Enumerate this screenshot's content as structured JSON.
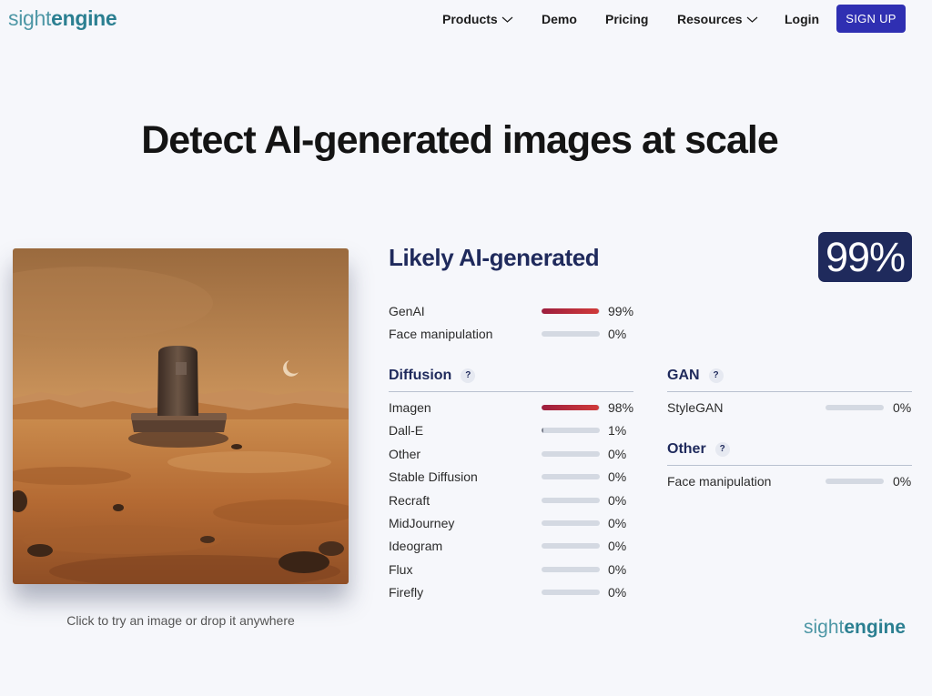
{
  "nav": {
    "logo_part1": "sight",
    "logo_part2": "engine",
    "items": [
      {
        "label": "Products",
        "has_dropdown": true
      },
      {
        "label": "Demo",
        "has_dropdown": false
      },
      {
        "label": "Pricing",
        "has_dropdown": false
      },
      {
        "label": "Resources",
        "has_dropdown": true
      },
      {
        "label": "Login",
        "has_dropdown": false
      }
    ],
    "signup_label": "SIGN UP"
  },
  "hero": {
    "title": "Detect AI-generated images at scale"
  },
  "demo": {
    "drop_hint": "Click to try an image or drop it anywhere"
  },
  "result": {
    "verdict": "Likely AI-generated",
    "score": "99%",
    "summary": [
      {
        "label": "GenAI",
        "value": 99,
        "pct": "99%"
      },
      {
        "label": "Face manipulation",
        "value": 0,
        "pct": "0%"
      }
    ],
    "diffusion": {
      "title": "Diffusion",
      "help": "?",
      "rows": [
        {
          "label": "Imagen",
          "value": 98,
          "pct": "98%"
        },
        {
          "label": "Dall-E",
          "value": 1,
          "pct": "1%"
        },
        {
          "label": "Other",
          "value": 0,
          "pct": "0%"
        },
        {
          "label": "Stable Diffusion",
          "value": 0,
          "pct": "0%"
        },
        {
          "label": "Recraft",
          "value": 0,
          "pct": "0%"
        },
        {
          "label": "MidJourney",
          "value": 0,
          "pct": "0%"
        },
        {
          "label": "Ideogram",
          "value": 0,
          "pct": "0%"
        },
        {
          "label": "Flux",
          "value": 0,
          "pct": "0%"
        },
        {
          "label": "Firefly",
          "value": 0,
          "pct": "0%"
        }
      ]
    },
    "gan": {
      "title": "GAN",
      "help": "?",
      "rows": [
        {
          "label": "StyleGAN",
          "value": 0,
          "pct": "0%"
        }
      ]
    },
    "other": {
      "title": "Other",
      "help": "?",
      "rows": [
        {
          "label": "Face manipulation",
          "value": 0,
          "pct": "0%"
        }
      ]
    }
  },
  "footer_logo": {
    "part1": "sight",
    "part2": "engine"
  },
  "colors": {
    "brand_teal": "#2b7f91",
    "signup_bg": "#2f2fb2",
    "navy": "#1f2a5c",
    "bar_fill": "#c0303c",
    "bar_track": "#d4d9e2"
  }
}
